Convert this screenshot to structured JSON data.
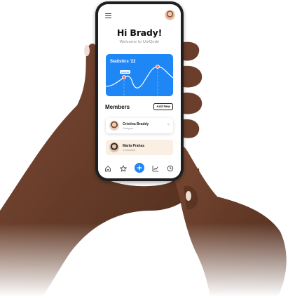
{
  "app": {
    "greeting": "Hi Brady!",
    "welcome": "Welcome to UniQode"
  },
  "header": {
    "menu_icon": "hamburger-menu-icon",
    "avatar_icon": "user-avatar"
  },
  "statistics": {
    "title": "Statistics '22",
    "tag": "Lorem",
    "accent_color": "#1f86f5",
    "highlight_color": "#ff6b6b"
  },
  "members": {
    "title": "Members",
    "add_label": "Add New",
    "items": [
      {
        "name": "Cristina Braddy",
        "role": "Designer",
        "icon": "heart-icon"
      },
      {
        "name": "Maria Prahas",
        "role": "Consultant"
      }
    ]
  },
  "nav": {
    "items": [
      "home-icon",
      "star-icon",
      "plus-icon",
      "chart-icon",
      "history-icon"
    ]
  }
}
